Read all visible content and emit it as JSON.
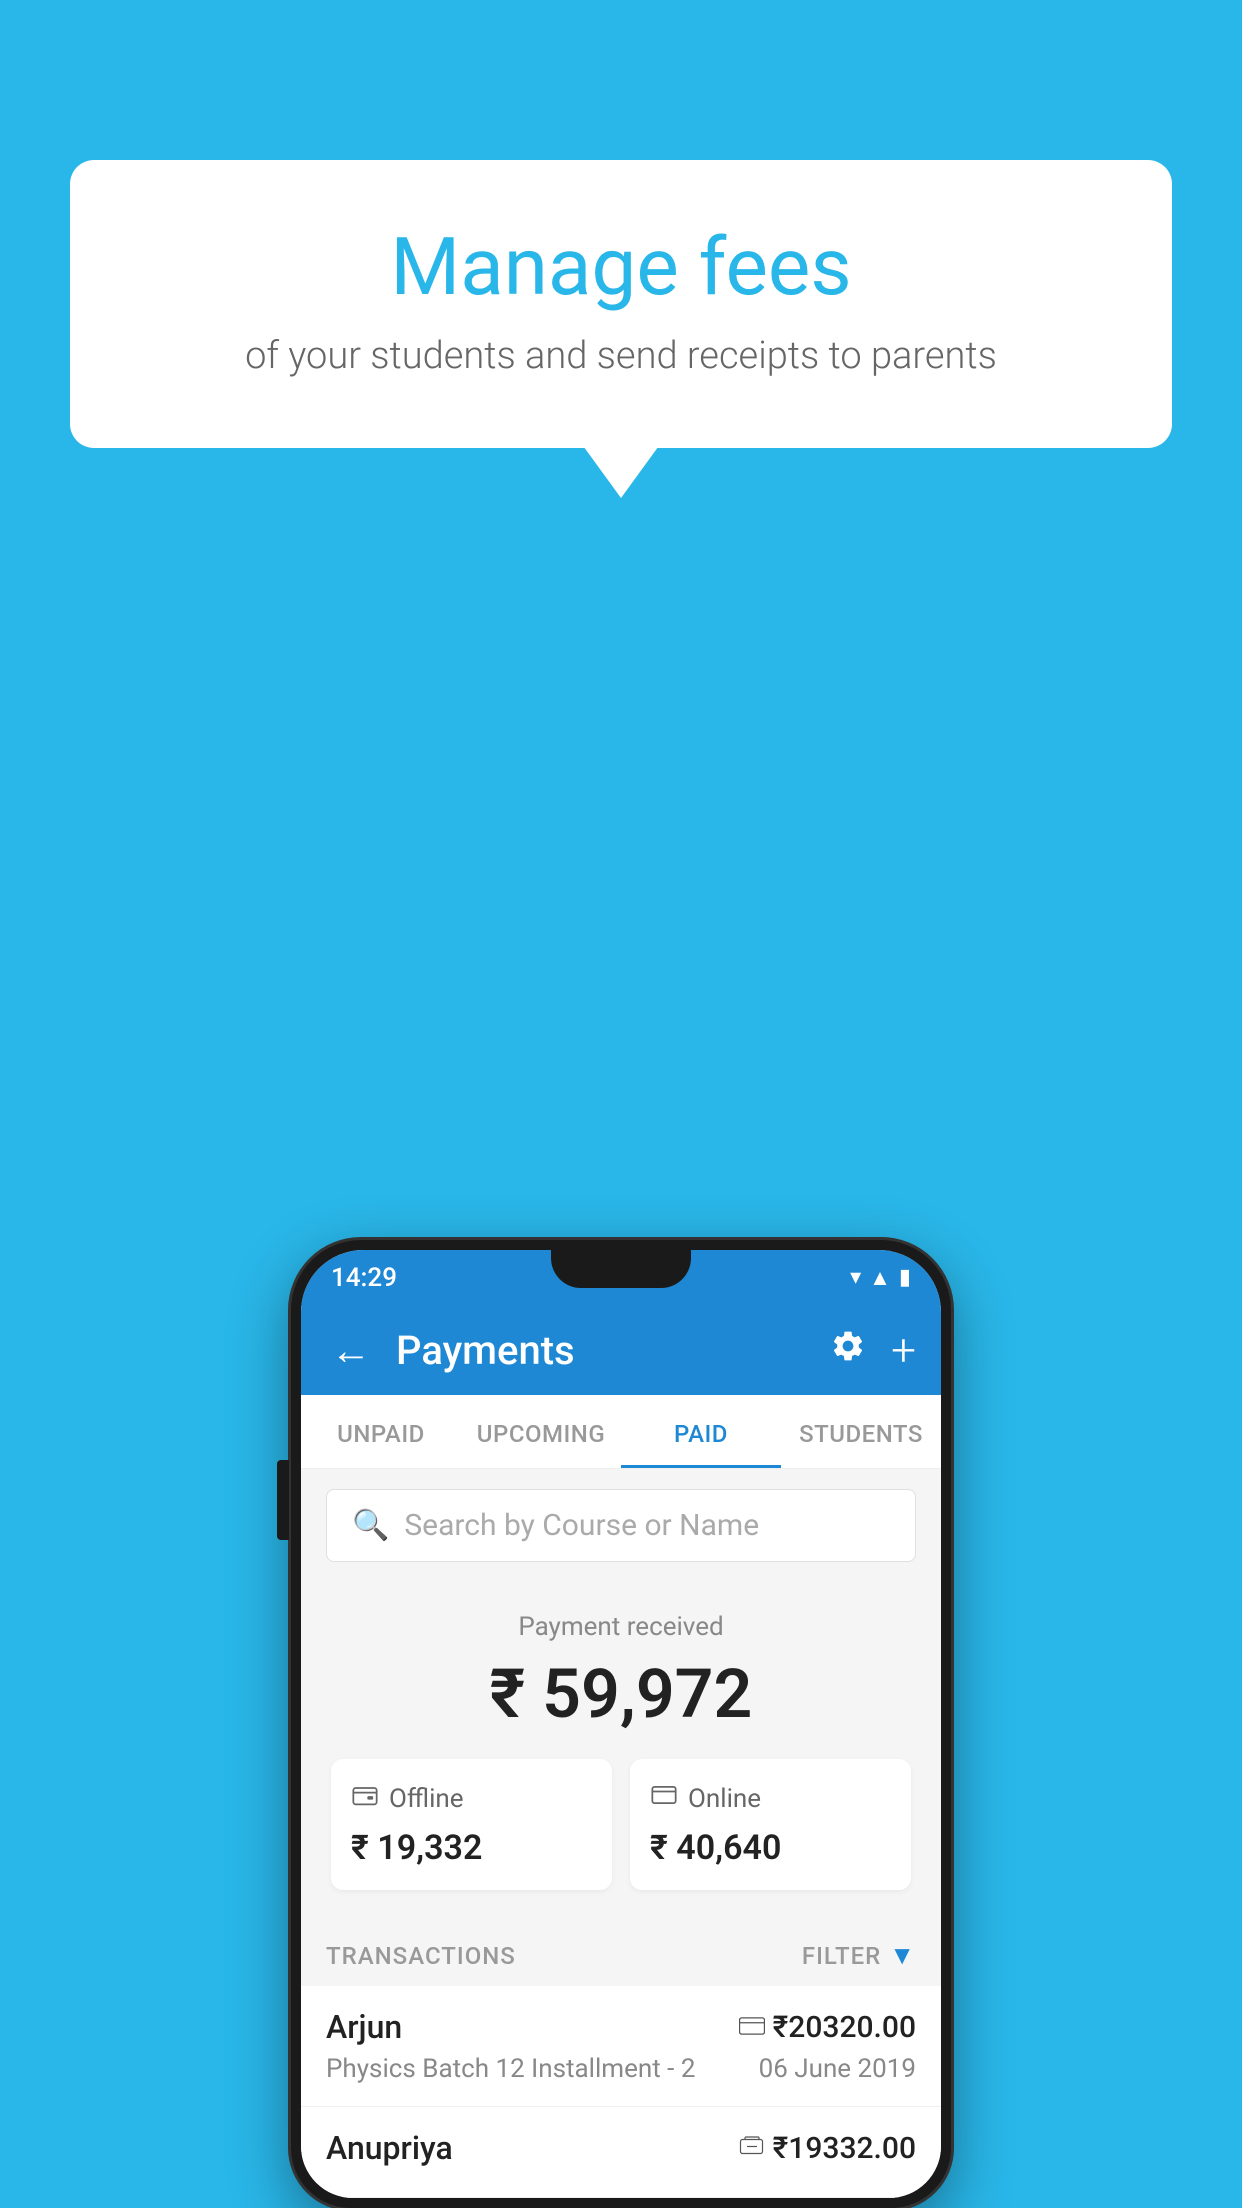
{
  "background_color": "#29B6E8",
  "bubble": {
    "title": "Manage fees",
    "subtitle": "of your students and send receipts to parents"
  },
  "phone": {
    "status_bar": {
      "time": "14:29"
    },
    "app_bar": {
      "title": "Payments",
      "back_icon": "←",
      "plus_label": "+"
    },
    "tabs": [
      {
        "label": "UNPAID",
        "active": false
      },
      {
        "label": "UPCOMING",
        "active": false
      },
      {
        "label": "PAID",
        "active": true
      },
      {
        "label": "STUDENTS",
        "active": false
      }
    ],
    "search": {
      "placeholder": "Search by Course or Name"
    },
    "payment_summary": {
      "received_label": "Payment received",
      "total_amount": "₹ 59,972",
      "offline": {
        "label": "Offline",
        "amount": "₹ 19,332"
      },
      "online": {
        "label": "Online",
        "amount": "₹ 40,640"
      }
    },
    "transactions": {
      "header_label": "TRANSACTIONS",
      "filter_label": "FILTER",
      "items": [
        {
          "name": "Arjun",
          "course": "Physics Batch 12 Installment - 2",
          "amount": "₹20320.00",
          "date": "06 June 2019",
          "payment_type": "online"
        },
        {
          "name": "Anupriya",
          "course": "",
          "amount": "₹19332.00",
          "date": "",
          "payment_type": "offline"
        }
      ]
    }
  }
}
